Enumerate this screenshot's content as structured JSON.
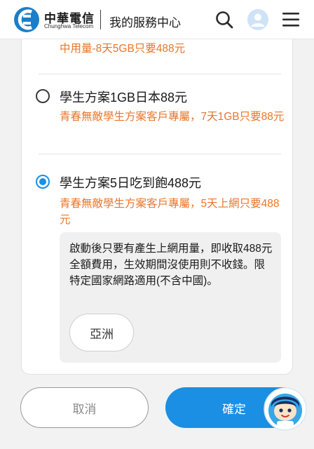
{
  "header": {
    "brand_zh": "中華電信",
    "brand_en": "Chunghwa Telecom",
    "page_title": "我的服務中心",
    "icons": [
      "chunghwa-logo-icon",
      "search-icon",
      "user-avatar-icon",
      "hamburger-menu-icon"
    ]
  },
  "plans": {
    "prev_desc": "中用量-8天5GB只要488元",
    "items": [
      {
        "name": "學生方案1GB日本88元",
        "desc": "青春無敵學生方案客戶專屬，7天1GB只要88元",
        "selected": false
      },
      {
        "name": "學生方案5日吃到飽488元",
        "desc": "青春無敵學生方案客戶專屬，5天上網只要488元",
        "selected": true
      }
    ],
    "info": "啟動後只要有產生上網用量，即收取488元全額費用，生效期間沒使用則不收錢。限特定國家網路適用(不含中國)。",
    "region_button": "亞洲"
  },
  "footer": {
    "cancel_label": "取消",
    "confirm_label": "確定"
  },
  "colors": {
    "accent_blue": "#1a8fe3",
    "description_orange": "#e9762b",
    "info_bg": "#f0f0f0"
  }
}
